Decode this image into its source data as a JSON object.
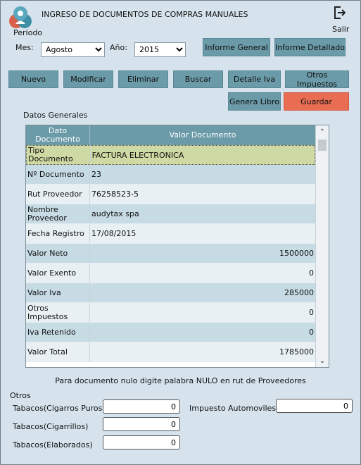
{
  "window": {
    "title": "INGRESO DE DOCUMENTOS DE COMPRAS MANUALES",
    "periodo_label": "Periodo",
    "salir_label": "Salir"
  },
  "period": {
    "mes_label": "Mes:",
    "mes_value": "Agosto",
    "anio_label": "Año:",
    "anio_value": "2015"
  },
  "reports": {
    "general": "Informe General",
    "detallado": "Informe Detallado"
  },
  "toolbar": {
    "nuevo": "Nuevo",
    "modificar": "Modificar",
    "eliminar": "Eliminar",
    "buscar": "Buscar",
    "detalle_iva": "Detalle Iva",
    "otros_impuestos": "Otros Impuestos",
    "genera_libro": "Genera Libro",
    "guardar": "Guardar"
  },
  "datos": {
    "section_title": "Datos Generales",
    "header_key": "Dato Documento",
    "header_value": "Valor Documento",
    "rows": [
      {
        "key": "Tipo Documento",
        "value": "FACTURA ELECTRONICA"
      },
      {
        "key": "Nº Documento",
        "value": "23"
      },
      {
        "key": "Rut Proveedor",
        "value": "76258523-5"
      },
      {
        "key": "Nombre Proveedor",
        "value": "audytax spa"
      },
      {
        "key": "Fecha Registro",
        "value": "17/08/2015"
      },
      {
        "key": "Valor Neto",
        "value": "1500000"
      },
      {
        "key": "Valor Exento",
        "value": "0"
      },
      {
        "key": "Valor Iva",
        "value": "285000"
      },
      {
        "key": "Otros Impuestos",
        "value": "0"
      },
      {
        "key": "Iva Retenido",
        "value": "0"
      },
      {
        "key": "Valor Total",
        "value": "1785000"
      }
    ]
  },
  "note": "Para documento nulo digite palabra NULO en rut de Proveedores",
  "otros": {
    "title": "Otros",
    "tabacos_puros_label": "Tabacos(Cigarros Puros)",
    "tabacos_puros_value": "0",
    "tabacos_cigarrillos_label": "Tabacos(Cigarrillos)",
    "tabacos_cigarrillos_value": "0",
    "tabacos_elaborados_label": "Tabacos(Elaborados)",
    "tabacos_elaborados_value": "0",
    "impuesto_automoviles_label": "Impuesto Automoviles",
    "impuesto_automoviles_value": "0"
  }
}
